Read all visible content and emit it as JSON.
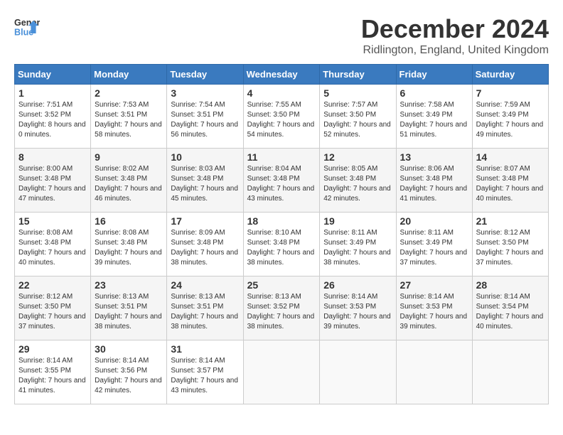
{
  "header": {
    "logo_line1": "General",
    "logo_line2": "Blue",
    "month_title": "December 2024",
    "location": "Ridlington, England, United Kingdom"
  },
  "days_of_week": [
    "Sunday",
    "Monday",
    "Tuesday",
    "Wednesday",
    "Thursday",
    "Friday",
    "Saturday"
  ],
  "weeks": [
    [
      {
        "day": 1,
        "rise": "7:51 AM",
        "set": "3:52 PM",
        "daylight": "8 hours and 0 minutes."
      },
      {
        "day": 2,
        "rise": "7:53 AM",
        "set": "3:51 PM",
        "daylight": "7 hours and 58 minutes."
      },
      {
        "day": 3,
        "rise": "7:54 AM",
        "set": "3:51 PM",
        "daylight": "7 hours and 56 minutes."
      },
      {
        "day": 4,
        "rise": "7:55 AM",
        "set": "3:50 PM",
        "daylight": "7 hours and 54 minutes."
      },
      {
        "day": 5,
        "rise": "7:57 AM",
        "set": "3:50 PM",
        "daylight": "7 hours and 52 minutes."
      },
      {
        "day": 6,
        "rise": "7:58 AM",
        "set": "3:49 PM",
        "daylight": "7 hours and 51 minutes."
      },
      {
        "day": 7,
        "rise": "7:59 AM",
        "set": "3:49 PM",
        "daylight": "7 hours and 49 minutes."
      }
    ],
    [
      {
        "day": 8,
        "rise": "8:00 AM",
        "set": "3:48 PM",
        "daylight": "7 hours and 47 minutes."
      },
      {
        "day": 9,
        "rise": "8:02 AM",
        "set": "3:48 PM",
        "daylight": "7 hours and 46 minutes."
      },
      {
        "day": 10,
        "rise": "8:03 AM",
        "set": "3:48 PM",
        "daylight": "7 hours and 45 minutes."
      },
      {
        "day": 11,
        "rise": "8:04 AM",
        "set": "3:48 PM",
        "daylight": "7 hours and 43 minutes."
      },
      {
        "day": 12,
        "rise": "8:05 AM",
        "set": "3:48 PM",
        "daylight": "7 hours and 42 minutes."
      },
      {
        "day": 13,
        "rise": "8:06 AM",
        "set": "3:48 PM",
        "daylight": "7 hours and 41 minutes."
      },
      {
        "day": 14,
        "rise": "8:07 AM",
        "set": "3:48 PM",
        "daylight": "7 hours and 40 minutes."
      }
    ],
    [
      {
        "day": 15,
        "rise": "8:08 AM",
        "set": "3:48 PM",
        "daylight": "7 hours and 40 minutes."
      },
      {
        "day": 16,
        "rise": "8:08 AM",
        "set": "3:48 PM",
        "daylight": "7 hours and 39 minutes."
      },
      {
        "day": 17,
        "rise": "8:09 AM",
        "set": "3:48 PM",
        "daylight": "7 hours and 38 minutes."
      },
      {
        "day": 18,
        "rise": "8:10 AM",
        "set": "3:48 PM",
        "daylight": "7 hours and 38 minutes."
      },
      {
        "day": 19,
        "rise": "8:11 AM",
        "set": "3:49 PM",
        "daylight": "7 hours and 38 minutes."
      },
      {
        "day": 20,
        "rise": "8:11 AM",
        "set": "3:49 PM",
        "daylight": "7 hours and 37 minutes."
      },
      {
        "day": 21,
        "rise": "8:12 AM",
        "set": "3:50 PM",
        "daylight": "7 hours and 37 minutes."
      }
    ],
    [
      {
        "day": 22,
        "rise": "8:12 AM",
        "set": "3:50 PM",
        "daylight": "7 hours and 37 minutes."
      },
      {
        "day": 23,
        "rise": "8:13 AM",
        "set": "3:51 PM",
        "daylight": "7 hours and 38 minutes."
      },
      {
        "day": 24,
        "rise": "8:13 AM",
        "set": "3:51 PM",
        "daylight": "7 hours and 38 minutes."
      },
      {
        "day": 25,
        "rise": "8:13 AM",
        "set": "3:52 PM",
        "daylight": "7 hours and 38 minutes."
      },
      {
        "day": 26,
        "rise": "8:14 AM",
        "set": "3:53 PM",
        "daylight": "7 hours and 39 minutes."
      },
      {
        "day": 27,
        "rise": "8:14 AM",
        "set": "3:53 PM",
        "daylight": "7 hours and 39 minutes."
      },
      {
        "day": 28,
        "rise": "8:14 AM",
        "set": "3:54 PM",
        "daylight": "7 hours and 40 minutes."
      }
    ],
    [
      {
        "day": 29,
        "rise": "8:14 AM",
        "set": "3:55 PM",
        "daylight": "7 hours and 41 minutes."
      },
      {
        "day": 30,
        "rise": "8:14 AM",
        "set": "3:56 PM",
        "daylight": "7 hours and 42 minutes."
      },
      {
        "day": 31,
        "rise": "8:14 AM",
        "set": "3:57 PM",
        "daylight": "7 hours and 43 minutes."
      },
      null,
      null,
      null,
      null
    ]
  ],
  "labels": {
    "sunrise": "Sunrise:",
    "sunset": "Sunset:",
    "daylight": "Daylight:"
  }
}
